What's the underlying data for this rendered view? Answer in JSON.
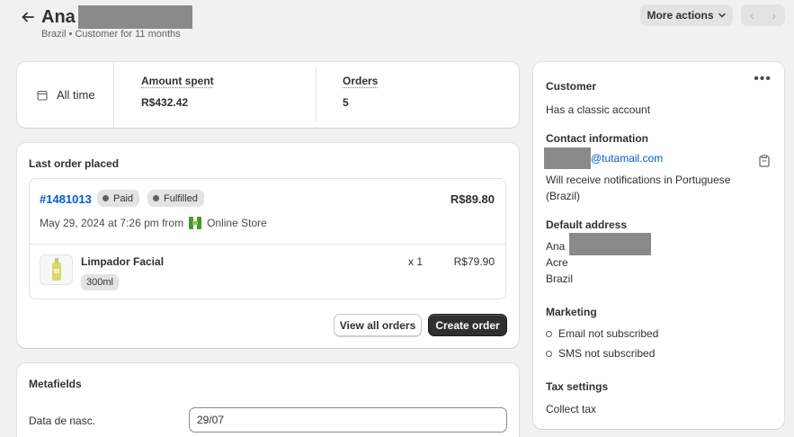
{
  "header": {
    "title": "Ana",
    "subtitle": "Brazil • Customer for 11 months",
    "more_actions_label": "More actions",
    "prev_label": "‹",
    "next_label": "›"
  },
  "stats": {
    "period_label": "All time",
    "amount_spent_label": "Amount spent",
    "amount_spent_value": "R$432.42",
    "orders_label": "Orders",
    "orders_value": "5"
  },
  "last_order": {
    "heading": "Last order placed",
    "order_number": "#1481013",
    "payment_status": "Paid",
    "fulfillment_status": "Fulfilled",
    "total": "R$89.80",
    "date_text": "May 29, 2024 at 7:26 pm from",
    "channel": "Online Store",
    "item": {
      "name": "Limpador Facial",
      "variant": "300ml",
      "quantity": "x 1",
      "price": "R$79.90"
    },
    "view_all_label": "View all orders",
    "create_order_label": "Create order"
  },
  "metafields": {
    "heading": "Metafields",
    "fields": [
      {
        "label": "Data de nasc.",
        "value": "29/07"
      }
    ]
  },
  "customer": {
    "heading": "Customer",
    "account_type": "Has a classic account",
    "contact_heading": "Contact information",
    "email_domain": "@tutamail.com",
    "notification_text": "Will receive notifications in Portuguese (Brazil)",
    "address_heading": "Default address",
    "address_lines": [
      "Ana",
      "Acre",
      "Brazil"
    ],
    "marketing_heading": "Marketing",
    "email_marketing": "Email not subscribed",
    "sms_marketing": "SMS not subscribed",
    "tax_heading": "Tax settings",
    "tax_value": "Collect tax"
  },
  "colors": {
    "link": "#005bd3",
    "primary_button": "#303030",
    "page_bg": "#f1f1f1",
    "redaction": "#8a8a8a",
    "channel_icon": "#3d9a2e"
  },
  "icons": {
    "back": "arrow-left-icon",
    "calendar": "calendar-icon",
    "channel": "online-store-icon",
    "copy": "clipboard-icon",
    "menu": "more-horizontal-icon"
  }
}
